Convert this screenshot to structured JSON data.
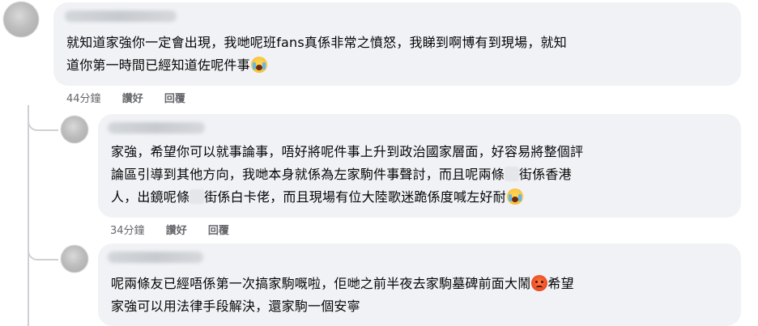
{
  "comments": [
    {
      "lines": [
        "就知道家強你一定會出現，我哋呢班fans真係非常之憤怒，我睇到啊博有到現場，就知",
        "道你第一時間已經知道佐呢件事"
      ],
      "emoji": "loudly-crying-face-icon",
      "time": "44分鐘",
      "like": "讚好",
      "reply": "回覆"
    },
    {
      "line1": "家強，希望你可以就事論事，唔好將呢件事上升到政治國家層面，好容易將整個評",
      "line2a": "論區引導到其他方向，我哋本身就係為左家駒件事聲討，而且呢兩條",
      "line2b": "街係香港",
      "line3a": "人，出鏡呢條",
      "line3b": "街係白卡佬，而且現場有位大陸歌迷跪係度喊左好耐",
      "emoji": "loudly-crying-face-icon",
      "time": "34分鐘",
      "like": "讚好",
      "reply": "回覆"
    },
    {
      "line1": "呢兩條友已經唔係第一次搞家駒嘅啦，佢哋之前半夜去家駒墓碑前面大鬧",
      "line1b": "希望",
      "line2": "家強可以用法律手段解決，還家駒一個安寧",
      "emoji": "angry-face-icon"
    }
  ],
  "colors": {
    "bubble": "#f0f2f5",
    "meta_text": "#65676b",
    "thread_line": "#ced0d4"
  }
}
